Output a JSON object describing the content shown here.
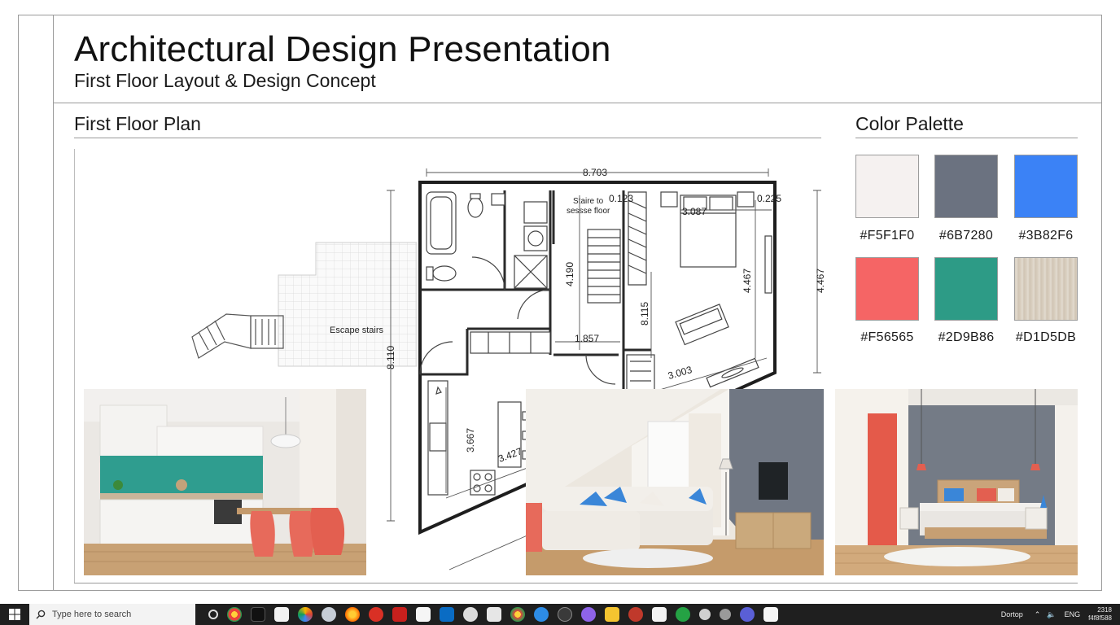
{
  "header": {
    "title": "Architectural Design Presentation",
    "subtitle": "First Floor Layout & Design Concept"
  },
  "plan": {
    "section_title": "First Floor Plan",
    "labels": {
      "escape_stairs": "Escape stairs",
      "stairs_to_line1": "Staire to",
      "stairs_to_line2": "sessse floor"
    },
    "dimensions": {
      "top_width": "8.703",
      "top_small": "0.123",
      "top_right": "0.225",
      "bedroom_width": "3.087",
      "hall_height": "4.190",
      "bedroom_height": "4.467",
      "outer_height": "4.467",
      "corridor_width": "1.857",
      "stair_height": "8.115",
      "diagonal": "3.003",
      "left_height": "8.110",
      "kitchen_height": "3.667",
      "kitchen_width": "3.427"
    }
  },
  "palette": {
    "section_title": "Color Palette",
    "colors": [
      {
        "label": "#F5F1F0",
        "hex": "#F5F1F0"
      },
      {
        "label": "#6B7280",
        "hex": "#6B7280"
      },
      {
        "label": "#3B82F6",
        "hex": "#3B82F6"
      },
      {
        "label": "#F56565",
        "hex": "#F56565"
      },
      {
        "label": "#2D9B86",
        "hex": "#2D9B86"
      },
      {
        "label": "#D1D5DB",
        "hex": "#D9CFC0"
      }
    ]
  },
  "taskbar": {
    "search_placeholder": "Type here to search",
    "desktop_label": "Dortop",
    "language": "ENG",
    "time": "2318",
    "date": "f4f8f588",
    "app_icons": [
      "chrome-icon",
      "tiktok-icon",
      "maps-icon",
      "photos-icon",
      "cloud-icon",
      "firefox-icon",
      "spotify-icon",
      "acrobat-icon",
      "calendar-icon",
      "outlook-icon",
      "whatsapp-icon",
      "code-icon",
      "chrome-alt-icon",
      "edge-icon",
      "shield-icon",
      "discord-icon",
      "files-icon",
      "media-icon",
      "paint-icon",
      "phone-icon",
      "settings-icon",
      "audio-icon",
      "teams-icon",
      "feedback-icon"
    ]
  }
}
